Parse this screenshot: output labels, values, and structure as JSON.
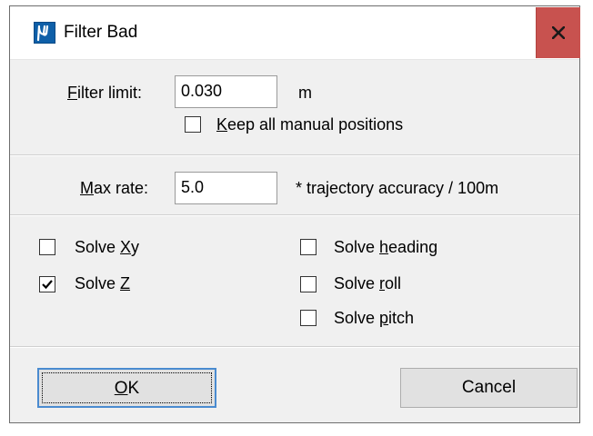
{
  "window": {
    "title": "Filter Bad",
    "close_label": "X"
  },
  "filter_limit": {
    "label_pre": "",
    "label_mnemonic": "F",
    "label_post": "ilter limit:",
    "value": "0.030",
    "unit": "m"
  },
  "keep_manual": {
    "label_mnemonic": "K",
    "label_post": "eep all manual positions",
    "checked": false
  },
  "max_rate": {
    "label_mnemonic": "M",
    "label_post": "ax rate:",
    "value": "5.0",
    "suffix": "* trajectory accuracy / 100m"
  },
  "solve": {
    "xy": {
      "pre": "Solve ",
      "mnemonic": "X",
      "post": "y",
      "checked": false
    },
    "z": {
      "pre": "Solve ",
      "mnemonic": "Z",
      "post": "",
      "checked": true
    },
    "heading": {
      "pre": "Solve ",
      "mnemonic": "h",
      "post": "eading",
      "checked": false
    },
    "roll": {
      "pre": "Solve ",
      "mnemonic": "r",
      "post": "oll",
      "checked": false
    },
    "pitch": {
      "pre": "Solve ",
      "mnemonic": "p",
      "post": "itch",
      "checked": false
    }
  },
  "buttons": {
    "ok_mnemonic": "O",
    "ok_post": "K",
    "cancel": "Cancel"
  },
  "colors": {
    "close_bg": "#c8524f",
    "default_button_border": "#4a8bd0",
    "app_icon_bg": "#0e5fa8"
  },
  "icons": {
    "app": "mu-app-icon",
    "close": "close-icon",
    "check": "checkmark-icon"
  }
}
